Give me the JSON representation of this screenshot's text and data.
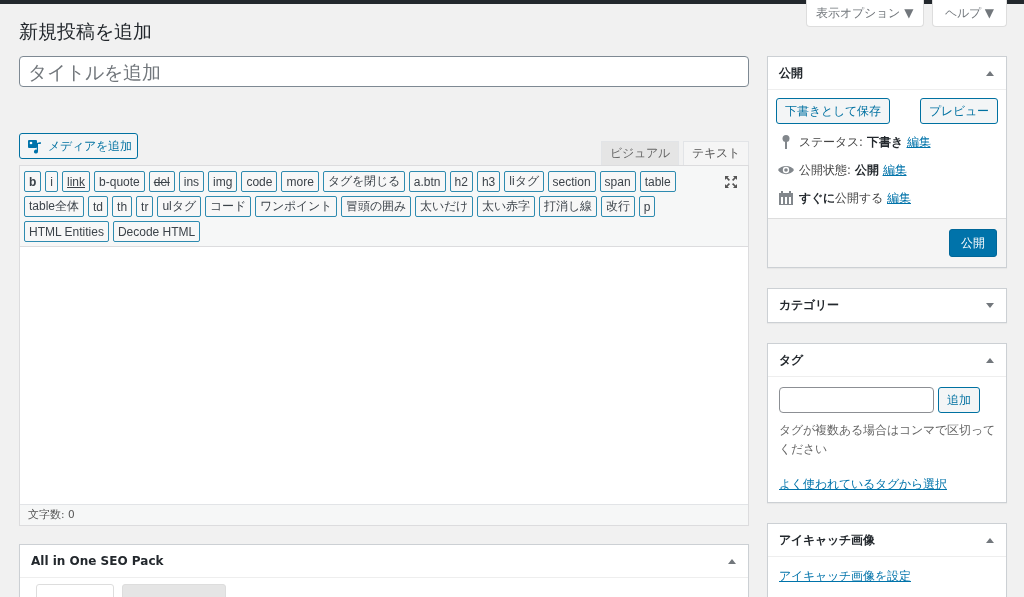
{
  "screen_options": [
    {
      "label": "表示オプション ▼"
    },
    {
      "label": "ヘルプ ▼"
    }
  ],
  "heading": "新規投稿を追加",
  "title_field": {
    "placeholder": "タイトルを追加"
  },
  "media_button": "メディアを追加",
  "editor_tabs": [
    {
      "label": "ビジュアル",
      "selected": false
    },
    {
      "label": "テキスト",
      "selected": true
    }
  ],
  "quicktags": [
    [
      {
        "label": "b",
        "kind": "bold"
      },
      {
        "label": "i",
        "kind": "plain"
      },
      {
        "label": "link",
        "kind": "link"
      },
      {
        "label": "b-quote",
        "kind": "plain"
      },
      {
        "label": "del",
        "kind": "del"
      },
      {
        "label": "ins",
        "kind": "plain"
      },
      {
        "label": "img",
        "kind": "plain"
      },
      {
        "label": "code",
        "kind": "plain"
      },
      {
        "label": "more",
        "kind": "plain"
      },
      {
        "label": "タグを閉じる",
        "kind": "plain"
      },
      {
        "label": "a.btn",
        "kind": "plain"
      },
      {
        "label": "h2",
        "kind": "plain"
      },
      {
        "label": "h3",
        "kind": "plain"
      },
      {
        "label": "liタグ",
        "kind": "plain"
      },
      {
        "label": "section",
        "kind": "plain"
      },
      {
        "label": "span",
        "kind": "plain"
      },
      {
        "label": "table",
        "kind": "plain"
      }
    ],
    [
      {
        "label": "table全体",
        "kind": "plain"
      },
      {
        "label": "td",
        "kind": "plain"
      },
      {
        "label": "th",
        "kind": "plain"
      },
      {
        "label": "tr",
        "kind": "plain"
      },
      {
        "label": "ulタグ",
        "kind": "plain"
      },
      {
        "label": "コード",
        "kind": "plain"
      },
      {
        "label": "ワンポイント",
        "kind": "plain"
      },
      {
        "label": "冒頭の囲み",
        "kind": "plain"
      },
      {
        "label": "太いだけ",
        "kind": "plain"
      },
      {
        "label": "太い赤字",
        "kind": "plain"
      },
      {
        "label": "打消し線",
        "kind": "plain"
      },
      {
        "label": "改行",
        "kind": "plain"
      },
      {
        "label": "p",
        "kind": "plain"
      }
    ],
    [
      {
        "label": "HTML Entities",
        "kind": "plain"
      },
      {
        "label": "Decode HTML",
        "kind": "plain"
      }
    ]
  ],
  "word_count": "文字数: 0",
  "seo_pack": {
    "title": "All in One SEO Pack",
    "expanded": true,
    "tabs": [
      {
        "selected": true
      },
      {
        "selected": false
      }
    ]
  },
  "publish": {
    "title": "公開",
    "expanded": true,
    "save_draft": "下書きとして保存",
    "preview": "プレビュー",
    "rows": [
      {
        "kind": "pin",
        "text": "ステータス: **下書き**",
        "link": "編集"
      },
      {
        "kind": "eye",
        "text": "公開状態: **公開**",
        "link": "編集"
      },
      {
        "kind": "calendar",
        "text": "**すぐに**公開する",
        "link": "編集"
      }
    ],
    "publish_button": "公開"
  },
  "categories": {
    "title": "カテゴリー",
    "expanded": false
  },
  "tags": {
    "title": "タグ",
    "expanded": true,
    "add_button": "追加",
    "hint": "タグが複数ある場合はコンマで区切ってください",
    "link": "よく使われているタグから選択"
  },
  "featured_image": {
    "title": "アイキャッチ画像",
    "expanded": true,
    "link": "アイキャッチ画像を設定"
  }
}
